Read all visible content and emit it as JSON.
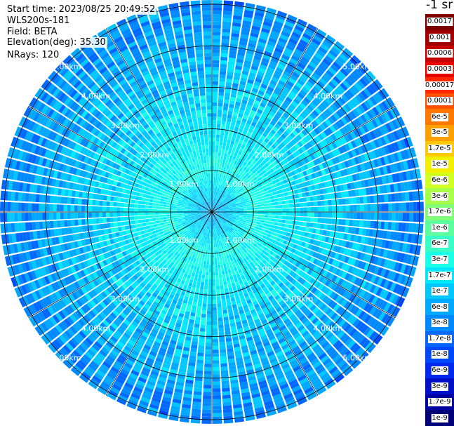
{
  "info": {
    "start_time": "Start time: 2023/08/25 20:49:52",
    "instrument": "WLS200s-181",
    "field": "Field: BETA",
    "elevation": "Elevation(deg): 35.30",
    "nrays": "NRays: 120"
  },
  "colorbar": {
    "title": "-1 sr",
    "levels": [
      {
        "label": "0.0017",
        "color": "#7f0000"
      },
      {
        "label": "0.001",
        "color": "#a00000"
      },
      {
        "label": "0.0006",
        "color": "#c40000"
      },
      {
        "label": "0.0003",
        "color": "#e80000"
      },
      {
        "label": "0.00017",
        "color": "#ff2800"
      },
      {
        "label": "0.0001",
        "color": "#ff5000"
      },
      {
        "label": "6e-5",
        "color": "#ff7800"
      },
      {
        "label": "3e-5",
        "color": "#ffa000"
      },
      {
        "label": "1.7e-5",
        "color": "#ffc800"
      },
      {
        "label": "1e-5",
        "color": "#f0f000"
      },
      {
        "label": "6e-6",
        "color": "#d0ff20"
      },
      {
        "label": "3e-6",
        "color": "#a8ff48"
      },
      {
        "label": "1.7e-6",
        "color": "#80ff78"
      },
      {
        "label": "1e-6",
        "color": "#5cffa0"
      },
      {
        "label": "6e-7",
        "color": "#38ffc8"
      },
      {
        "label": "3e-7",
        "color": "#1affe8"
      },
      {
        "label": "1.7e-7",
        "color": "#00e8ff"
      },
      {
        "label": "1e-7",
        "color": "#00c8ff"
      },
      {
        "label": "6e-8",
        "color": "#00a8ff"
      },
      {
        "label": "3e-8",
        "color": "#0088ff"
      },
      {
        "label": "1.7e-8",
        "color": "#0068ff"
      },
      {
        "label": "1e-8",
        "color": "#0048ff"
      },
      {
        "label": "6e-9",
        "color": "#0028f0"
      },
      {
        "label": "3e-9",
        "color": "#0010c8"
      },
      {
        "label": "1.7e-9",
        "color": "#0000a0"
      },
      {
        "label": "1e-9",
        "color": "#000078"
      }
    ]
  },
  "chart_data": {
    "type": "heatmap",
    "projection": "polar (PPI scan)",
    "field": "BETA",
    "unit": "-1 sr",
    "range_rings_km": [
      1.0,
      2.0,
      3.0,
      4.0,
      5.0
    ],
    "ring_labels": [
      "1.00km",
      "2.00km",
      "3.00km",
      "4.00km",
      "5.00km"
    ],
    "spoke_count": 12,
    "nrays": 120,
    "profile": {
      "range_km": [
        0.0,
        1.0,
        2.0,
        3.0,
        4.0,
        5.0
      ],
      "typical_level_index": [
        18,
        15,
        16,
        17,
        18,
        19
      ]
    },
    "colors": {
      "ring_line": "#000000",
      "ring_label": "#ffffff",
      "background": "#ffffff"
    }
  }
}
